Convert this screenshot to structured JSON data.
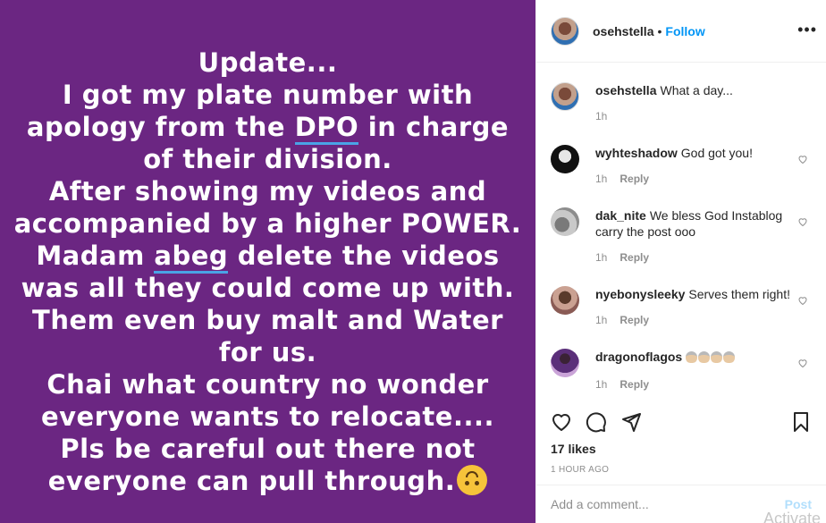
{
  "story": {
    "lines": [
      "Update...",
      "I got my plate number with",
      "apology from the DPO in charge",
      "of their division.",
      "After showing my videos and",
      "accompanied by a higher POWER.",
      "Madam abeg delete the videos",
      "was all they could come up with.",
      "Them even buy malt and Water",
      "for us.",
      "Chai what country no wonder",
      "everyone wants to relocate....",
      "Pls be careful out there not",
      "everyone can pull through."
    ],
    "underlined_words": [
      "DPO",
      "abeg"
    ],
    "background_color": "#6b2682"
  },
  "header": {
    "username": "osehstella",
    "separator": "•",
    "follow_label": "Follow",
    "more_label": "•••"
  },
  "comments": [
    {
      "username": "osehstella",
      "text": "What a day...",
      "time": "1h",
      "reply": ""
    },
    {
      "username": "wyhteshadow",
      "text": "God got you!",
      "time": "1h",
      "reply": "Reply"
    },
    {
      "username": "dak_nite",
      "text": "We bless God Instablog carry the post ooo",
      "time": "1h",
      "reply": "Reply"
    },
    {
      "username": "nyebonysleeky",
      "text": "Serves them right!",
      "time": "1h",
      "reply": "Reply"
    },
    {
      "username": "dragonoflagos",
      "text": "",
      "time": "1h",
      "reply": "Reply"
    }
  ],
  "likes": "17 likes",
  "timestamp": "1 HOUR AGO",
  "add_comment": {
    "placeholder": "Add a comment...",
    "post_label": "Post"
  },
  "watermark": "Activate",
  "colors": {
    "accent": "#0095f6",
    "muted": "#8e8e8e",
    "post_disabled": "#b2dffc"
  }
}
